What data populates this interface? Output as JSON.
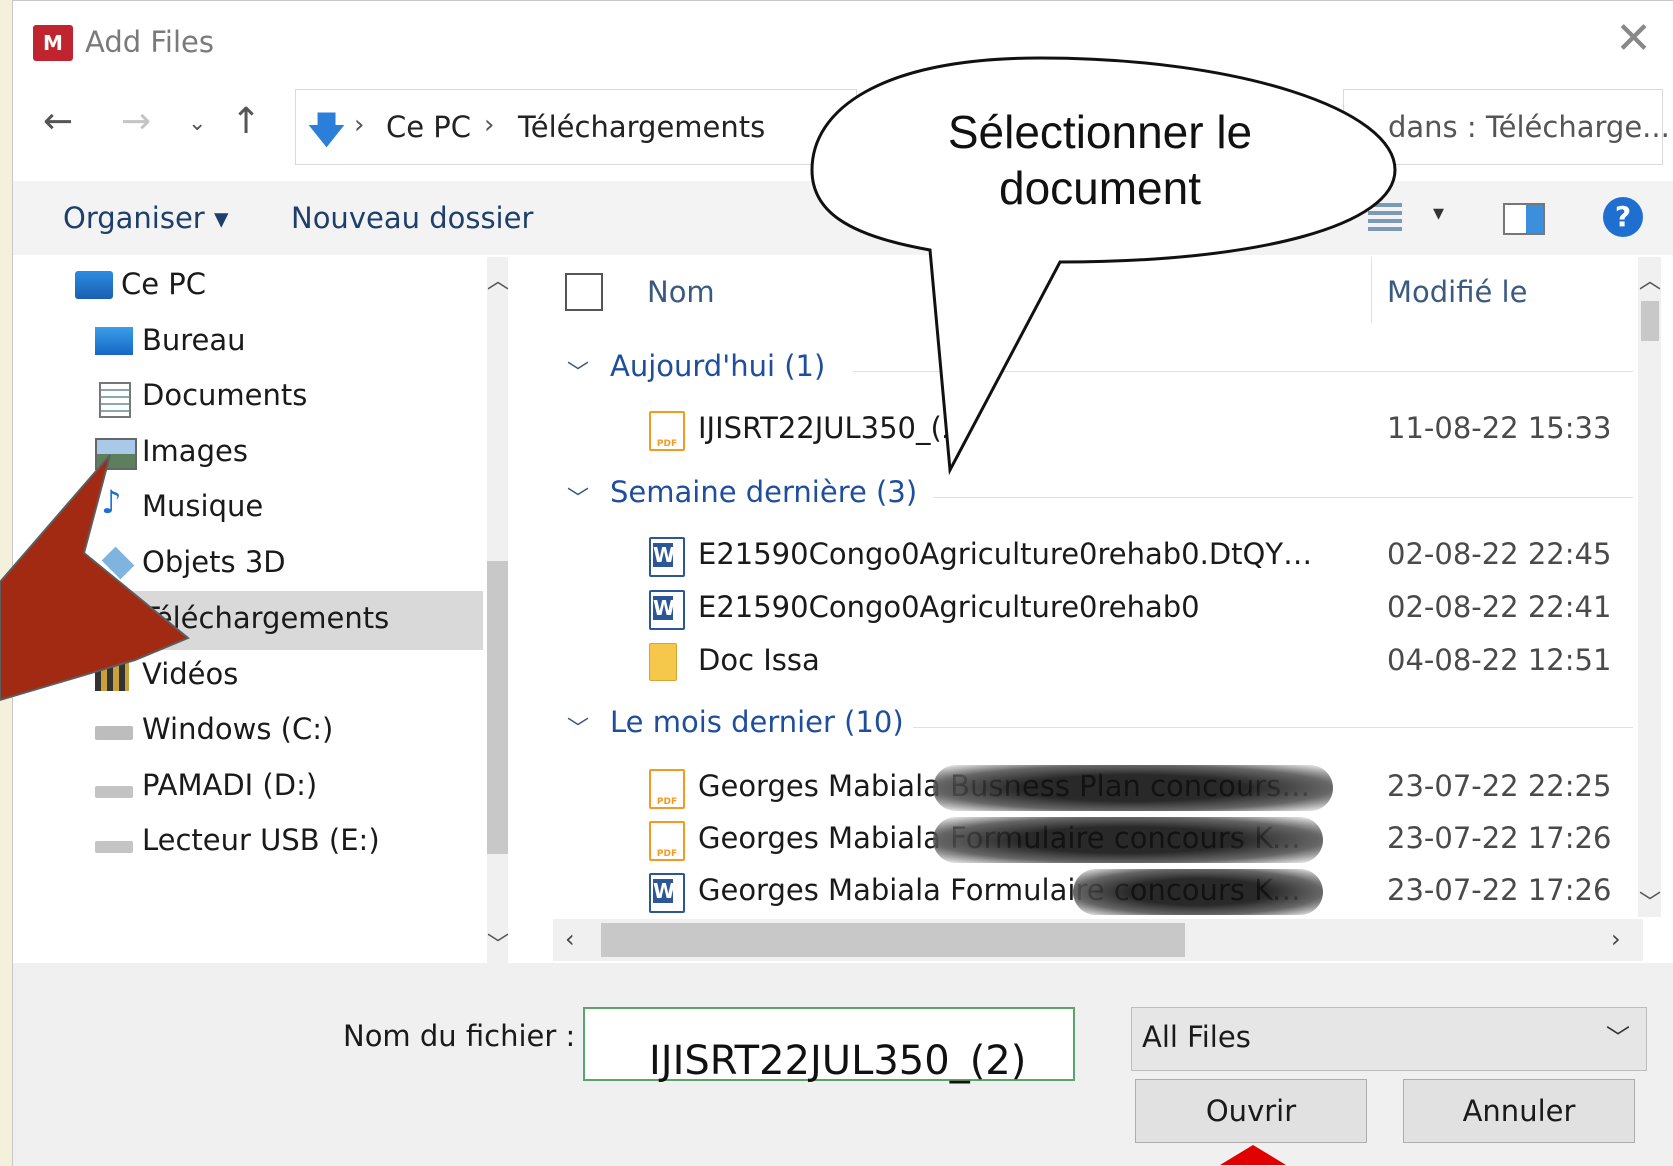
{
  "window": {
    "title": "Add Files",
    "app_icon_text": "M"
  },
  "nav_buttons": {
    "back": "←",
    "forward": "→",
    "recent": "⌄",
    "up": "↑"
  },
  "address": {
    "root": "Ce PC",
    "current": "Téléchargements",
    "separator": "›"
  },
  "search": {
    "placeholder": "dans : Télécharge..."
  },
  "toolbar": {
    "organize": "Organiser ▾",
    "new_folder": "Nouveau dossier",
    "help": "?"
  },
  "nav_pane": {
    "items": [
      {
        "label": "Ce PC",
        "icon": "computer-icon"
      },
      {
        "label": "Bureau",
        "icon": "desktop-icon"
      },
      {
        "label": "Documents",
        "icon": "documents-icon"
      },
      {
        "label": "Images",
        "icon": "pictures-icon"
      },
      {
        "label": "Musique",
        "icon": "music-icon"
      },
      {
        "label": "Objets 3D",
        "icon": "3d-objects-icon"
      },
      {
        "label": "Téléchargements",
        "icon": "downloads-icon",
        "selected": true
      },
      {
        "label": "Vidéos",
        "icon": "videos-icon"
      },
      {
        "label": "Windows (C:)",
        "icon": "drive-icon"
      },
      {
        "label": "PAMADI (D:)",
        "icon": "drive-icon"
      },
      {
        "label": "Lecteur USB (E:)",
        "icon": "usb-drive-icon"
      }
    ]
  },
  "columns": {
    "name": "Nom",
    "modified": "Modifié le"
  },
  "groups": [
    {
      "label": "Aujourd'hui (1)",
      "files": [
        {
          "name": "IJISRT22JUL350_(2)",
          "date": "11-08-22 15:33",
          "type": "pdf"
        }
      ]
    },
    {
      "label": "Semaine dernière (3)",
      "files": [
        {
          "name": "E21590Congo0Agriculture0rehab0.DtQY4J-6...",
          "date": "02-08-22 22:45",
          "type": "word"
        },
        {
          "name": "E21590Congo0Agriculture0rehab0",
          "date": "02-08-22 22:41",
          "type": "word"
        },
        {
          "name": "Doc Issa",
          "date": "04-08-22 12:51",
          "type": "folder"
        }
      ]
    },
    {
      "label": "Le mois dernier (10)",
      "files": [
        {
          "name": "Georges Mabiala Busness Plan concours Ko...",
          "date": "23-07-22 22:25",
          "type": "pdf"
        },
        {
          "name": "Georges Mabiala Formulaire concours Koma ...",
          "date": "23-07-22 17:26",
          "type": "pdf"
        },
        {
          "name": "Georges Mabiala Formulaire concours Koma ...",
          "date": "23-07-22 17:26",
          "type": "word"
        }
      ]
    }
  ],
  "bottom": {
    "filename_label": "Nom du fichier :",
    "filename_value": "IJISRT22JUL350_(2)",
    "filter": "All Files",
    "open": "Ouvrir",
    "cancel": "Annuler"
  },
  "callout": {
    "text": "Sélectionner le document"
  },
  "colors": {
    "accent": "#1f4e9c",
    "arrow_red": "#a32a12",
    "selection": "#d9d9d9"
  }
}
